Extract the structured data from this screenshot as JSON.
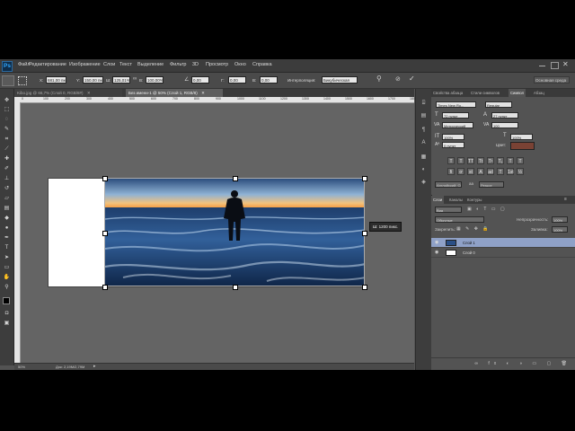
{
  "app": {
    "logo": "Ps"
  },
  "menu": [
    "Файл",
    "Редактирование",
    "Изображение",
    "Слои",
    "Текст",
    "Выделение",
    "Фильтр",
    "3D",
    "Просмотр",
    "Окно",
    "Справка"
  ],
  "options": {
    "x_label": "X:",
    "x_value": "681,00 пкс",
    "y_label": "Y:",
    "y_value": "150,00 пкс",
    "w_label": "Ш:",
    "w_value": "125,01%",
    "h_label": "В:",
    "h_value": "100,00%",
    "angle_value": "0,00",
    "hskew_label": "Г:",
    "hskew_value": "0,00",
    "vskew_label": "В:",
    "vskew_value": "0,00",
    "interp_label": "Интерполяция:",
    "interp_value": "Бикубическая",
    "workspace_value": "Основная среда"
  },
  "tabs": [
    {
      "label": "Kibo.jpg @ 66,7% (Слой 0, RGB/8#)",
      "active": false
    },
    {
      "label": "Без имени-1 @ 50% (Слой 1, RGB/8)",
      "active": true
    }
  ],
  "ruler_marks": [
    "0",
    "100",
    "200",
    "300",
    "400",
    "500",
    "600",
    "700",
    "800",
    "900",
    "1000",
    "1100",
    "1200",
    "1300",
    "1400",
    "1500",
    "1600",
    "1700",
    "1800"
  ],
  "canvas": {
    "tooltip": "Ш: 1200 пикс."
  },
  "status": {
    "zoom": "50%",
    "doc": "Док: 2,19M/2,79M"
  },
  "character_panel": {
    "tabs": [
      "Свойства абзаца",
      "Стили символов",
      "Символ",
      "Абзац"
    ],
    "active_tab": 2,
    "font_family": "Times New Ro...",
    "font_style": "Regular",
    "font_size": "72 пункт",
    "leading": "27 пункт",
    "kerning": "Метрический",
    "tracking": "100",
    "vscale": "100%",
    "hscale": "100%",
    "baseline": "0 пункт",
    "color_label": "Цвет:",
    "color": "#7a4234",
    "type_buttons": [
      "T",
      "T",
      "TT",
      "Tt",
      "T¹",
      "T₁",
      "T",
      "T"
    ],
    "extra_buttons": [
      "fi",
      "ơ",
      "st",
      "A",
      "ad",
      "T",
      "1st",
      "½"
    ],
    "language": "Английский: США",
    "antialias": "Резкое"
  },
  "layers_panel": {
    "tabs": [
      "Слои",
      "Каналы",
      "Контуры"
    ],
    "active_tab": 0,
    "kind_label": "Вид",
    "blend_mode": "Обычные",
    "opacity_label": "Непрозрачность:",
    "opacity_value": "100%",
    "lock_label": "Закрепить:",
    "fill_label": "Заливка:",
    "fill_value": "100%",
    "layers": [
      {
        "name": "Слой 1",
        "selected": true
      },
      {
        "name": "Слой 0",
        "selected": false
      }
    ]
  }
}
